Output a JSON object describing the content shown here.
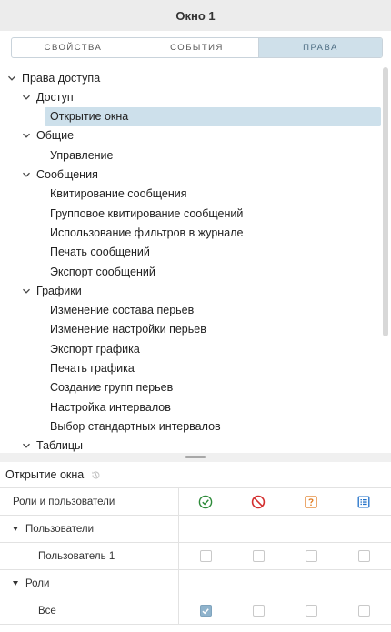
{
  "window": {
    "title": "Окно 1"
  },
  "tabs": [
    {
      "label": "СВОЙСТВА",
      "active": false
    },
    {
      "label": "СОБЫТИЯ",
      "active": false
    },
    {
      "label": "ПРАВА",
      "active": true
    }
  ],
  "tree": {
    "items": [
      {
        "label": "Права доступа",
        "level": 0,
        "expandable": true
      },
      {
        "label": "Доступ",
        "level": 1,
        "expandable": true
      },
      {
        "label": "Открытие окна",
        "level": 2,
        "expandable": false,
        "selected": true
      },
      {
        "label": "Общие",
        "level": 1,
        "expandable": true
      },
      {
        "label": "Управление",
        "level": 2,
        "expandable": false
      },
      {
        "label": "Сообщения",
        "level": 1,
        "expandable": true
      },
      {
        "label": "Квитирование сообщения",
        "level": 2,
        "expandable": false
      },
      {
        "label": "Групповое квитирование сообщений",
        "level": 2,
        "expandable": false
      },
      {
        "label": "Использование фильтров в журнале",
        "level": 2,
        "expandable": false
      },
      {
        "label": "Печать сообщений",
        "level": 2,
        "expandable": false
      },
      {
        "label": "Экспорт сообщений",
        "level": 2,
        "expandable": false
      },
      {
        "label": "Графики",
        "level": 1,
        "expandable": true
      },
      {
        "label": "Изменение состава перьев",
        "level": 2,
        "expandable": false
      },
      {
        "label": "Изменение настройки перьев",
        "level": 2,
        "expandable": false
      },
      {
        "label": "Экспорт графика",
        "level": 2,
        "expandable": false
      },
      {
        "label": "Печать графика",
        "level": 2,
        "expandable": false
      },
      {
        "label": "Создание групп перьев",
        "level": 2,
        "expandable": false
      },
      {
        "label": "Настройка интервалов",
        "level": 2,
        "expandable": false
      },
      {
        "label": "Выбор стандартных интервалов",
        "level": 2,
        "expandable": false
      },
      {
        "label": "Таблицы",
        "level": 1,
        "expandable": true
      }
    ]
  },
  "permissions": {
    "title": "Открытие окна",
    "header_label": "Роли и пользователи",
    "columns": [
      {
        "icon": "allow-icon",
        "color": "#2e8b3a"
      },
      {
        "icon": "deny-icon",
        "color": "#d32f2f"
      },
      {
        "icon": "question-icon",
        "color": "#e07a1f"
      },
      {
        "icon": "list-icon",
        "color": "#1e6fc8"
      }
    ],
    "rows": [
      {
        "type": "group",
        "label": "Пользователи"
      },
      {
        "type": "item",
        "label": "Пользователь 1",
        "checks": [
          false,
          false,
          false,
          false
        ]
      },
      {
        "type": "group",
        "label": "Роли"
      },
      {
        "type": "item",
        "label": "Все",
        "checks": [
          true,
          false,
          false,
          false
        ]
      }
    ]
  }
}
